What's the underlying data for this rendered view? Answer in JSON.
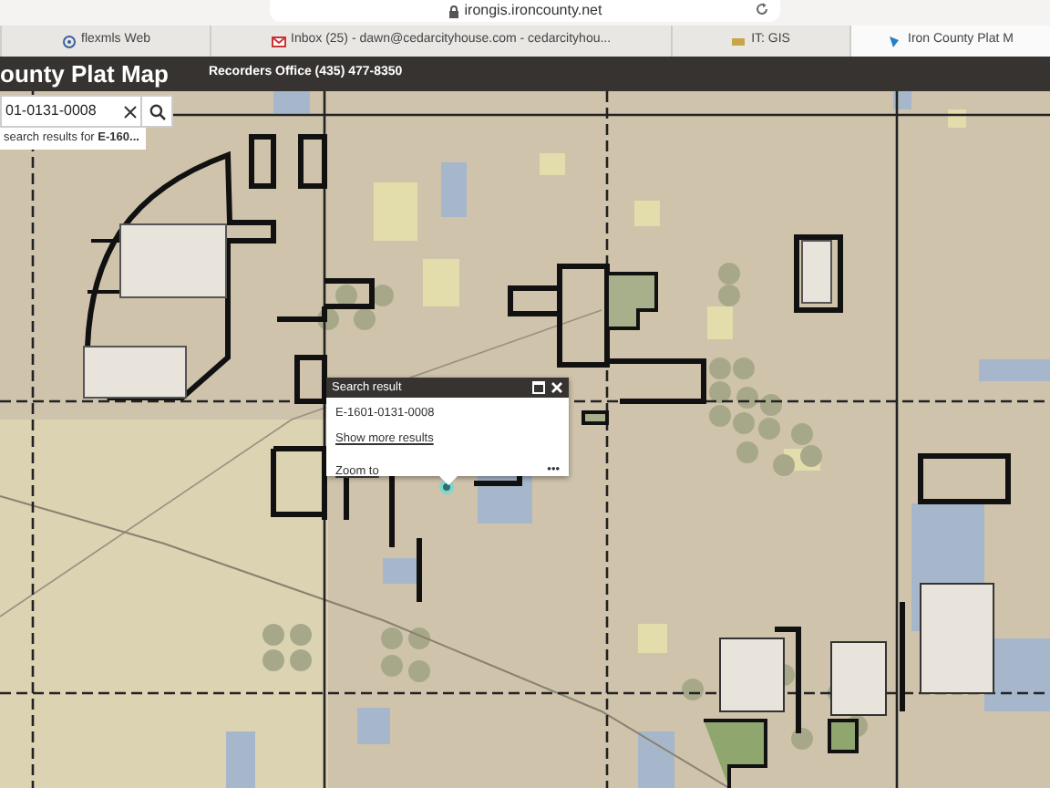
{
  "browser": {
    "url": "irongis.ironcounty.net",
    "tabs": [
      {
        "title": "flexmls Web",
        "selected": false
      },
      {
        "title": "Inbox (25) - dawn@cedarcityhouse.com - cedarcityhou...",
        "selected": false
      },
      {
        "title": "IT: GIS",
        "selected": false
      },
      {
        "title": "Iron County Plat M",
        "selected": true
      }
    ]
  },
  "header": {
    "title": "ounty Plat Map",
    "subtitle": "Recorders Office (435) 477-8350"
  },
  "search": {
    "value": "01-0131-0008",
    "suggestion": "search results for **E-160...**"
  },
  "popup": {
    "title": "Search result",
    "result": "E-1601-0131-0008",
    "more_link": "Show more results",
    "zoom_link": "Zoom to",
    "menu": "•••"
  }
}
